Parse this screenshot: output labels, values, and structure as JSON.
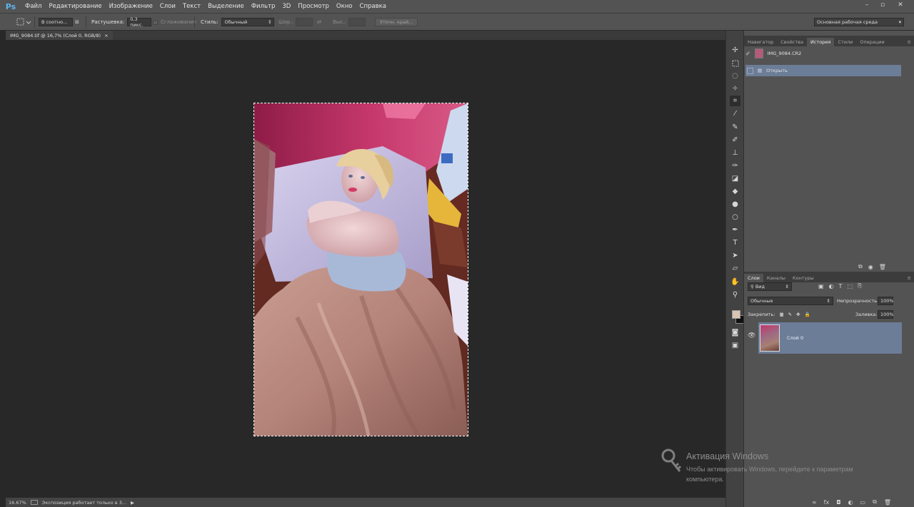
{
  "app": {
    "logo": "Ps"
  },
  "menu": [
    "Файл",
    "Редактирование",
    "Изображение",
    "Слои",
    "Текст",
    "Выделение",
    "Фильтр",
    "3D",
    "Просмотр",
    "Окно",
    "Справка"
  ],
  "options_bar": {
    "mode": "В соотно...",
    "feather_label": "Растушевка:",
    "feather_value": "0,3 пикс.",
    "antialias_label": "Сглаживание",
    "style_label": "Стиль:",
    "style_value": "Обычный",
    "width_label": "Шир.:",
    "height_label": "Выс.:",
    "refine_edge": "Уточн. край...",
    "workspace": "Основная рабочая среда"
  },
  "document": {
    "tab_title": "IMG_9084.tif @ 16,7% (Слой 0, RGB/8)",
    "close": "×"
  },
  "status_bar": {
    "zoom": "16.67%",
    "message": "Экспозиция работает только в 3..."
  },
  "panels": {
    "top_tabs": [
      "Навигатор",
      "Свойства",
      "История",
      "Стили",
      "Операции"
    ],
    "top_active": 2,
    "history": {
      "snapshot": "IMG_9084.CR2",
      "items": [
        "Открыть"
      ]
    },
    "layer_tabs": [
      "Слои",
      "Каналы",
      "Контуры"
    ],
    "layer_active": 0,
    "filter_kind": "Вид",
    "blend_mode": "Обычные",
    "opacity_label": "Непрозрачность:",
    "opacity_value": "100%",
    "lock_label": "Закрепить:",
    "fill_label": "Заливка:",
    "fill_value": "100%",
    "layers": [
      {
        "name": "Слой 0",
        "visible": true
      }
    ]
  },
  "colors": {
    "foreground": "#d8c5b4",
    "background": "#111111",
    "accent_selection": "#6c7d97"
  },
  "watermark": {
    "title": "Активация Windows",
    "line1": "Чтобы активировать Windows, перейдите к параметрам",
    "line2": "компьютера."
  }
}
